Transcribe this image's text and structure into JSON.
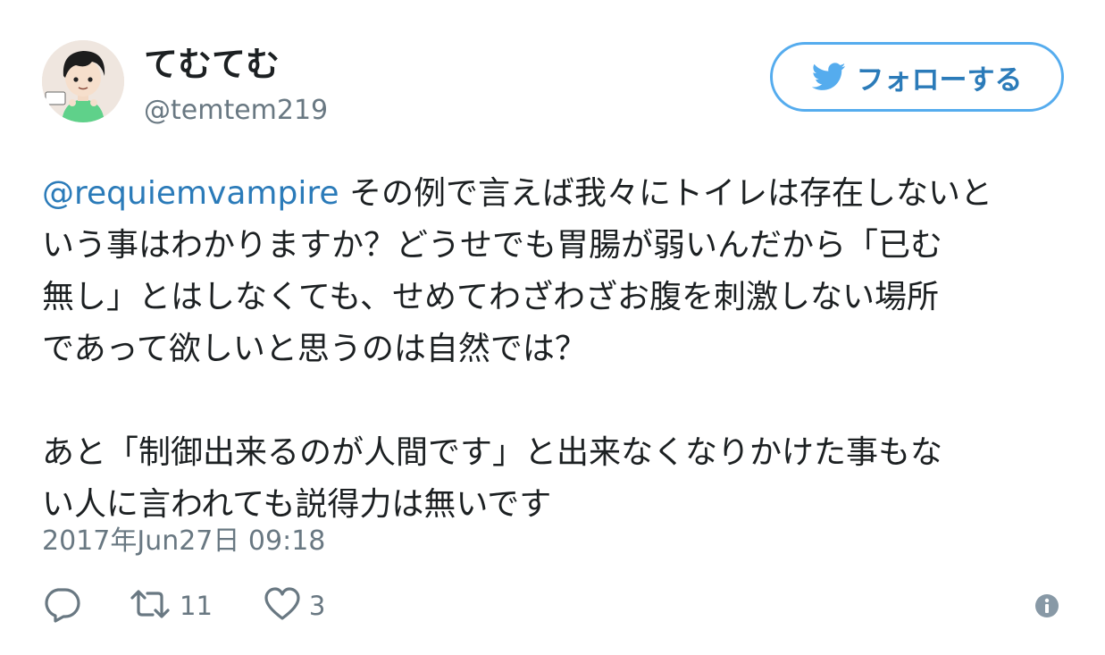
{
  "user": {
    "name": "てむてむ",
    "handle": "@temtem219"
  },
  "follow_button": {
    "label": "フォローする",
    "icon": "twitter-bird-icon"
  },
  "tweet": {
    "mention": "@requiemvampire",
    "paragraph1": {
      "line1_rest": "その例で言えば我々にトイレは存在しないと",
      "line2": "いう事はわかりますか？どうせでも胃腸が弱いんだから「已む",
      "line3": "無し」とはしなくても、せめてわざわざお腹を刺激しない場所",
      "line4": "であって欲しいと思うのは自然では？"
    },
    "paragraph2": {
      "line1": "あと「制御出来るのが人間です」と出来なくなりかけた事もな",
      "line2": "い人に言われても説得力は無いです"
    },
    "timestamp": "2017年Jun27日 09:18"
  },
  "actions": {
    "reply_icon": "reply-icon",
    "retweet_icon": "retweet-icon",
    "retweet_count": "11",
    "like_icon": "heart-icon",
    "like_count": "3",
    "info_icon": "info-icon"
  },
  "colors": {
    "link_blue": "#2b7bb9",
    "twitter_blue": "#55acee",
    "muted_gray": "#697882",
    "text": "#1c2022"
  }
}
